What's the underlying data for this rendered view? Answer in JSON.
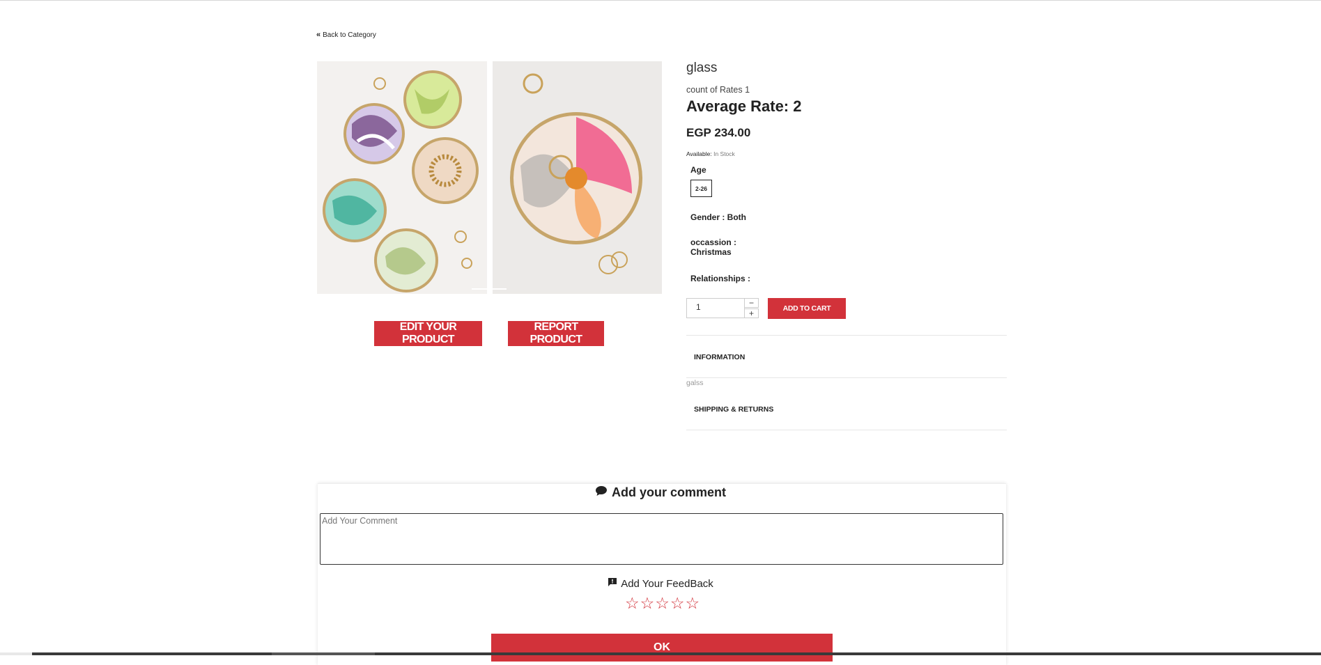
{
  "nav": {
    "back_label": "Back to Category"
  },
  "product": {
    "title": "glass",
    "count_rates": "count of Rates 1",
    "average_rate": "Average Rate: 2",
    "price": "EGP 234.00",
    "available_label": "Available:",
    "available_value": "In Stock",
    "age_label": "Age",
    "age_value": "2-26",
    "gender": "Gender : Both",
    "occasion_label": "occassion :",
    "occasion_value": "Christmas",
    "relationships": "Relationships :",
    "quantity": "1",
    "qty_minus": "−",
    "qty_plus": "+",
    "add_to_cart": "ADD TO CART"
  },
  "actions": {
    "edit": "EDIT YOUR PRODUCT",
    "report": "REPORT PRODUCT"
  },
  "tabs": {
    "information": "INFORMATION",
    "information_body": "galss",
    "shipping": "SHIPPING & RETURNS"
  },
  "comment": {
    "title": "Add your comment",
    "placeholder": "Add Your Comment",
    "feedback_title": "Add Your FeedBack",
    "stars": [
      "☆",
      "☆",
      "☆",
      "☆",
      "☆"
    ],
    "rating": 0,
    "ok": "OK"
  },
  "colors": {
    "accent": "#d2323a"
  },
  "icons": [
    "double-chevron-left-icon",
    "comment-icon",
    "feedback-icon",
    "star-outline-icon"
  ]
}
